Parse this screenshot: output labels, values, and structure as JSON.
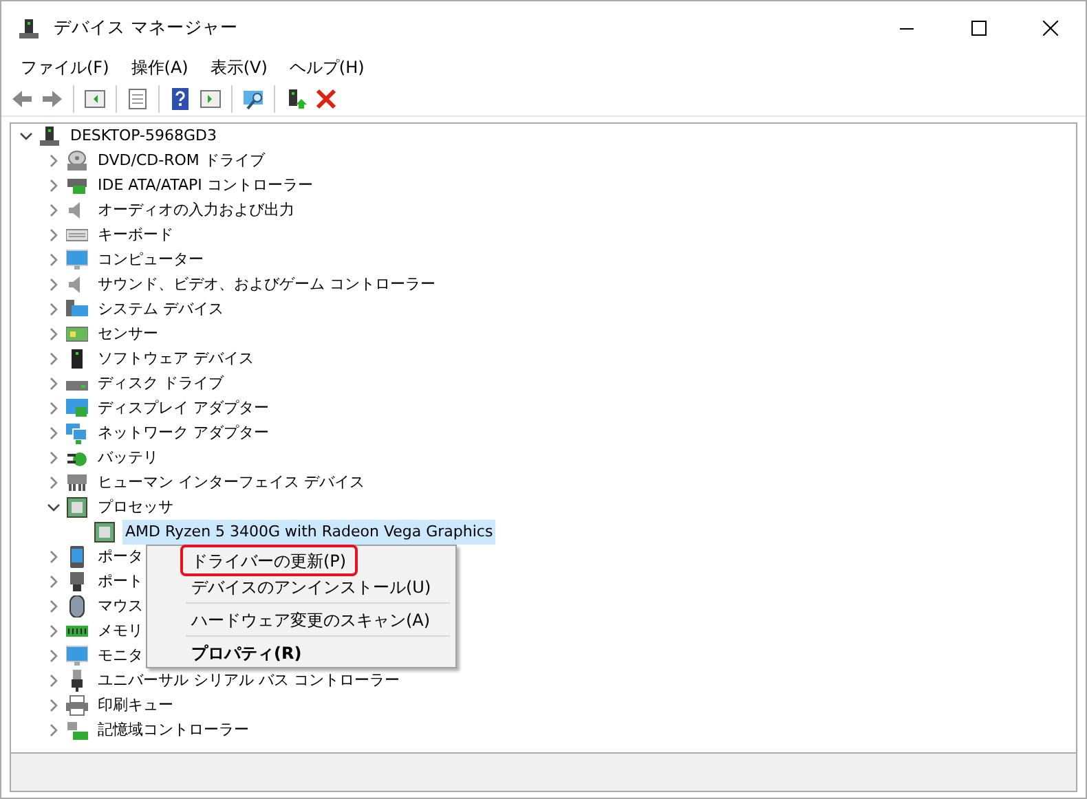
{
  "window": {
    "title": "デバイス マネージャー"
  },
  "menubar": [
    "ファイル(F)",
    "操作(A)",
    "表示(V)",
    "ヘルプ(H)"
  ],
  "tree": {
    "label": "DESKTOP-5968GD3",
    "expanded": true,
    "selected": false,
    "children": [
      {
        "label": "DVD/CD-ROM ドライブ",
        "expanded": false,
        "selected": false
      },
      {
        "label": "IDE ATA/ATAPI コントローラー",
        "expanded": false,
        "selected": false
      },
      {
        "label": "オーディオの入力および出力",
        "expanded": false,
        "selected": false
      },
      {
        "label": "キーボード",
        "expanded": false,
        "selected": false
      },
      {
        "label": "コンピューター",
        "expanded": false,
        "selected": false
      },
      {
        "label": "サウンド、ビデオ、およびゲーム コントローラー",
        "expanded": false,
        "selected": false
      },
      {
        "label": "システム デバイス",
        "expanded": false,
        "selected": false
      },
      {
        "label": "センサー",
        "expanded": false,
        "selected": false
      },
      {
        "label": "ソフトウェア デバイス",
        "expanded": false,
        "selected": false
      },
      {
        "label": "ディスク ドライブ",
        "expanded": false,
        "selected": false
      },
      {
        "label": "ディスプレイ アダプター",
        "expanded": false,
        "selected": false
      },
      {
        "label": "ネットワーク アダプター",
        "expanded": false,
        "selected": false
      },
      {
        "label": "バッテリ",
        "expanded": false,
        "selected": false
      },
      {
        "label": "ヒューマン インターフェイス デバイス",
        "expanded": false,
        "selected": false
      },
      {
        "label": "プロセッサ",
        "expanded": true,
        "selected": false,
        "children": [
          {
            "label": "AMD Ryzen 5 3400G with Radeon Vega Graphics",
            "selected": true
          }
        ]
      },
      {
        "label": "ポータ",
        "expanded": false,
        "selected": false
      },
      {
        "label": "ポート",
        "expanded": false,
        "selected": false
      },
      {
        "label": "マウス",
        "expanded": false,
        "selected": false
      },
      {
        "label": "メモリ",
        "expanded": false,
        "selected": false
      },
      {
        "label": "モニタ",
        "expanded": false,
        "selected": false
      },
      {
        "label": "ユニバーサル シリアル バス コントローラー",
        "expanded": false,
        "selected": false
      },
      {
        "label": "印刷キュー",
        "expanded": false,
        "selected": false
      },
      {
        "label": "記憶域コントローラー",
        "expanded": false,
        "selected": false
      }
    ]
  },
  "context_menu": [
    {
      "kind": "item",
      "label": "ドライバーの更新(P)",
      "outlined": true,
      "default": false
    },
    {
      "kind": "item",
      "label": "デバイスのアンインストール(U)",
      "outlined": false,
      "default": false
    },
    {
      "kind": "separator"
    },
    {
      "kind": "item",
      "label": "ハードウェア変更のスキャン(A)",
      "outlined": false,
      "default": false
    },
    {
      "kind": "separator"
    },
    {
      "kind": "item",
      "label": "プロパティ(R)",
      "outlined": false,
      "default": true
    }
  ]
}
